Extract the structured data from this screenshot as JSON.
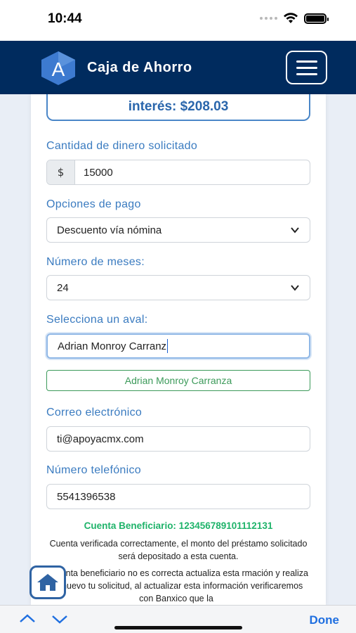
{
  "status_bar": {
    "time": "10:44"
  },
  "header": {
    "title": "Caja de Ahorro",
    "logo_letter": "A"
  },
  "interest": {
    "text": "interés: $208.03"
  },
  "amount": {
    "label": "Cantidad de dinero solicitado",
    "currency": "$",
    "value": "15000"
  },
  "payment": {
    "label": "Opciones de pago",
    "selected": "Descuento vía nómina"
  },
  "months": {
    "label": "Número de meses:",
    "selected": "24"
  },
  "guarantor": {
    "label": "Selecciona un aval:",
    "value": "Adrian Monroy Carranz",
    "suggestion": "Adrian Monroy Carranza"
  },
  "email": {
    "label": "Correo electrónico",
    "value": "ti@apoyacmx.com"
  },
  "phone": {
    "label": "Número telefónico",
    "value": "5541396538"
  },
  "beneficiary": {
    "title": "Cuenta Beneficiario: 123456789101112131",
    "verified_text": "Cuenta verificada correctamente, el monto del préstamo solicitado será depositado a esta cuenta.",
    "warning_text": "a cuenta beneficiario no es correcta actualiza esta rmación y realiza de nuevo tu solicitud, al actualizar esta información verificaremos con Banxico que la"
  },
  "accessory": {
    "done_label": "Done"
  },
  "colors": {
    "header": "#002b5e",
    "accent": "#3a7bc0",
    "success": "#1fb36a"
  },
  "icons": [
    "wifi-icon",
    "battery-icon",
    "menu-icon",
    "chevron-down-icon",
    "home-icon",
    "chevron-up-icon"
  ]
}
